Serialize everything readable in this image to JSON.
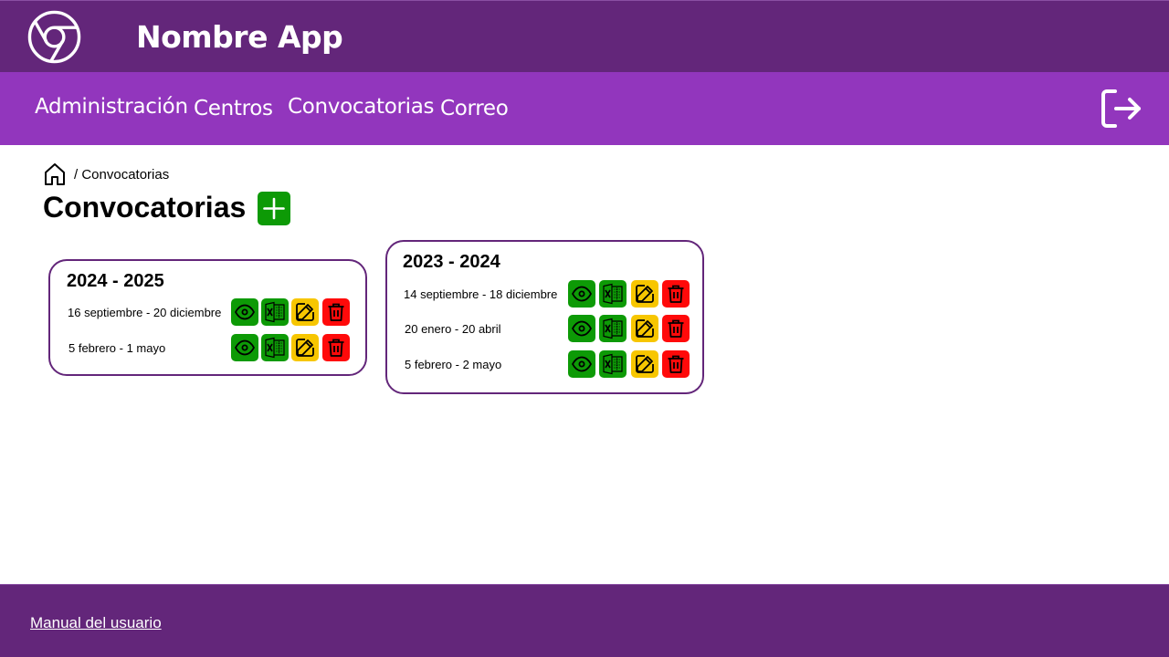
{
  "app": {
    "title": "Nombre App",
    "logo_icon": "chrome-logo-icon"
  },
  "nav": {
    "items": [
      {
        "label": "Administración"
      },
      {
        "label": "Centros"
      },
      {
        "label": "Convocatorias"
      },
      {
        "label": "Correo"
      }
    ],
    "logout_icon": "logout-icon"
  },
  "breadcrumb": {
    "home_icon": "home-icon",
    "current": "/ Convocatorias"
  },
  "page": {
    "title": "Convocatorias",
    "add_icon": "plus-icon"
  },
  "cards": [
    {
      "title": "2024 - 2025",
      "rows": [
        {
          "label": "16 septiembre - 20 diciembre"
        },
        {
          "label": "5 febrero - 1 mayo"
        }
      ]
    },
    {
      "title": "2023 - 2024",
      "rows": [
        {
          "label": "14 septiembre - 18 diciembre"
        },
        {
          "label": "20 enero - 20 abril"
        },
        {
          "label": "5 febrero - 2 mayo"
        }
      ]
    }
  ],
  "row_actions": [
    "eye-icon",
    "excel-icon",
    "edit-icon",
    "trash-icon"
  ],
  "colors": {
    "header": "#63267a",
    "navbar": "#9236bd",
    "view": "#0d9a06",
    "excel": "#0d9a06",
    "edit": "#f7c600",
    "delete": "#ff0a0a"
  },
  "footer": {
    "link": "Manual del usuario"
  }
}
